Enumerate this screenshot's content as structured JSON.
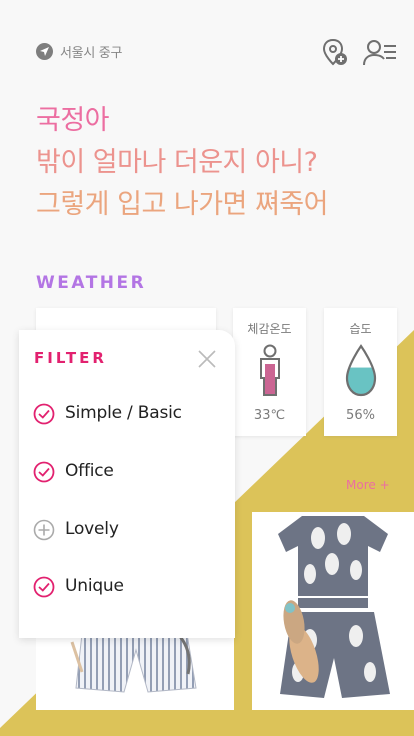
{
  "location": {
    "icon": "navigation-arrow-icon",
    "text": "서울시 중구"
  },
  "header_icons": {
    "pin": "map-pin-add-icon",
    "user": "user-list-icon"
  },
  "headline": {
    "line1": "국정아",
    "line2": "밖이 얼마나 더운지 아니?",
    "line3": "그렇게 입고 나가면 쪄죽어"
  },
  "weather": {
    "title": "WEATHER",
    "feel": {
      "label": "체감온도",
      "value": "33℃",
      "icon": "person-temperature-icon"
    },
    "humidity": {
      "label": "습도",
      "value": "56%",
      "icon": "water-drop-icon",
      "level": 0.56
    }
  },
  "more_label": "More +",
  "filter": {
    "title": "FILTER",
    "close_icon": "close-icon",
    "options": [
      {
        "label": "Simple / Basic",
        "checked": true
      },
      {
        "label": "Office",
        "checked": true
      },
      {
        "label": "Lovely",
        "checked": false
      },
      {
        "label": "Unique",
        "checked": true
      }
    ]
  },
  "colors": {
    "accent": "#e2216f",
    "weather_title": "#8a2bd6",
    "yellow": "#c9a400",
    "teal": "#1aa3a3"
  }
}
